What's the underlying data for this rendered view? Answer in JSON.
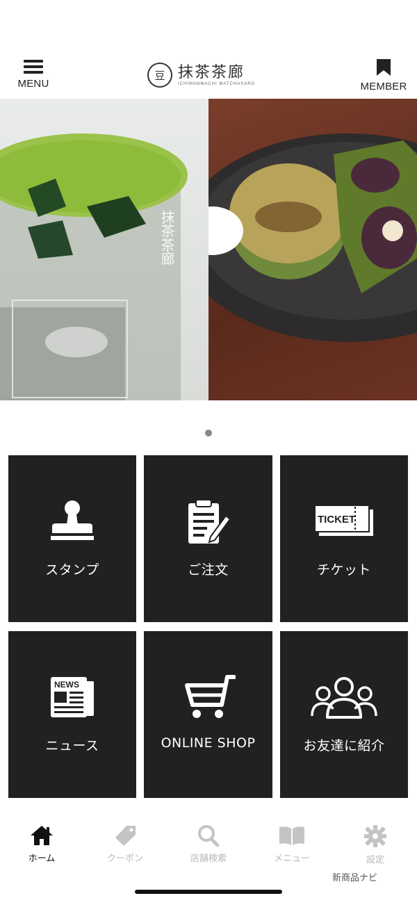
{
  "header": {
    "menu_label": "MENU",
    "member_label": "MEMBER",
    "logo_jp": "抹茶茶廊",
    "logo_en": "ICHIMANMACHI MATCHASARO",
    "logo_mark": "豆"
  },
  "hero": {
    "carousel_index": 1,
    "carousel_count": 1
  },
  "tiles": [
    {
      "label": "スタンプ",
      "icon": "stamp-icon"
    },
    {
      "label": "ご注文",
      "icon": "clipboard-order-icon"
    },
    {
      "label": "チケット",
      "icon": "ticket-icon",
      "icon_text": "TICKET"
    },
    {
      "label": "ニュース",
      "icon": "newspaper-icon",
      "icon_text": "NEWS"
    },
    {
      "label": "ONLINE SHOP",
      "icon": "shopping-cart-icon"
    },
    {
      "label": "お友達に紹介",
      "icon": "friends-icon"
    }
  ],
  "tabbar": {
    "items": [
      {
        "label": "ホーム",
        "icon": "home-icon",
        "active": true
      },
      {
        "label": "クーポン",
        "icon": "tag-icon",
        "active": false
      },
      {
        "label": "店舗検索",
        "icon": "search-icon",
        "active": false
      },
      {
        "label": "メニュー",
        "icon": "book-icon",
        "active": false
      },
      {
        "label": "設定",
        "icon": "gear-icon",
        "active": false
      }
    ]
  },
  "watermark": "新商品ナビ",
  "colors": {
    "tile_bg": "#222023",
    "tab_active": "#111111",
    "tab_inactive": "#b8b8b8"
  }
}
